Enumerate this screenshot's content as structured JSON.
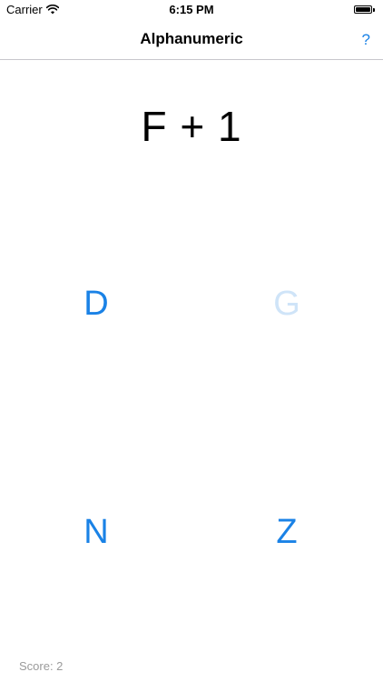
{
  "status_bar": {
    "carrier": "Carrier",
    "time": "6:15 PM"
  },
  "nav": {
    "title": "Alphanumeric",
    "help_label": "?"
  },
  "question": "F + 1",
  "answers": [
    {
      "label": "D",
      "state": "active"
    },
    {
      "label": "G",
      "state": "faded"
    },
    {
      "label": "N",
      "state": "active"
    },
    {
      "label": "Z",
      "state": "active"
    }
  ],
  "colors": {
    "accent": "#1a82e6",
    "faded_answer": "#cfe4f8",
    "score_text": "#9b9b9b"
  },
  "score_text": "Score: 2"
}
